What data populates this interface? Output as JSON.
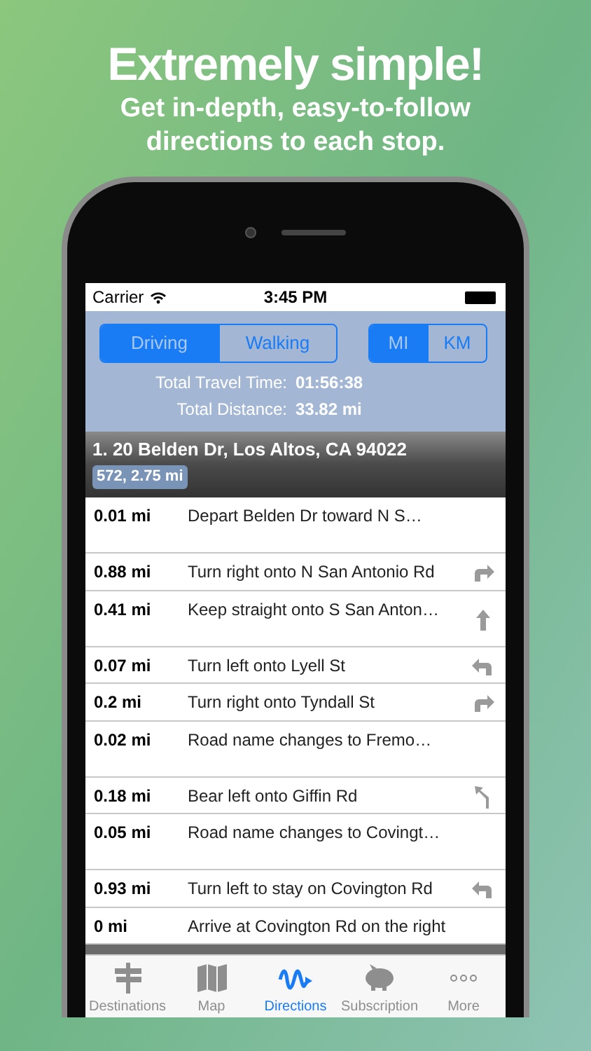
{
  "headline": "Extremely simple!",
  "subheadline": "Get in-depth, easy-to-follow directions to each stop.",
  "status_bar": {
    "carrier": "Carrier",
    "time": "3:45 PM"
  },
  "mode_tabs": [
    {
      "label": "Driving",
      "selected": true
    },
    {
      "label": "Walking",
      "selected": false
    }
  ],
  "unit_tabs": [
    {
      "label": "MI",
      "selected": true
    },
    {
      "label": "KM",
      "selected": false
    }
  ],
  "totals": [
    {
      "label": "Total Travel Time:",
      "value": "01:56:38"
    },
    {
      "label": "Total Distance:",
      "value": "33.82 mi"
    }
  ],
  "stop": {
    "title": "1. 20 Belden Dr, Los Altos, CA 94022",
    "badge": "572, 2.75 mi"
  },
  "steps": [
    {
      "distance": "0.01 mi",
      "instruction": "Depart Belden Dr toward N S…",
      "kind": "none",
      "two_line": true
    },
    {
      "distance": "0.88 mi",
      "instruction": "Turn right onto N San Antonio Rd",
      "kind": "right",
      "two_line": false
    },
    {
      "distance": "0.41 mi",
      "instruction": "Keep straight onto S San Anton…",
      "kind": "straight",
      "two_line": true
    },
    {
      "distance": "0.07 mi",
      "instruction": "Turn left onto Lyell St",
      "kind": "left",
      "two_line": false
    },
    {
      "distance": "0.2 mi",
      "instruction": "Turn right onto Tyndall St",
      "kind": "right",
      "two_line": false
    },
    {
      "distance": "0.02 mi",
      "instruction": "Road name changes to Fremo…",
      "kind": "none",
      "two_line": true
    },
    {
      "distance": "0.18 mi",
      "instruction": "Bear left onto Giffin Rd",
      "kind": "bear_left",
      "two_line": false
    },
    {
      "distance": "0.05 mi",
      "instruction": "Road name changes to Covingt…",
      "kind": "none",
      "two_line": true
    },
    {
      "distance": "0.93 mi",
      "instruction": "Turn left to stay on Covington Rd",
      "kind": "left",
      "two_line": false
    },
    {
      "distance": "0 mi",
      "instruction": "Arrive at Covington Rd on the right",
      "kind": "none",
      "two_line": false
    }
  ],
  "tab_bar": [
    {
      "label": "Destinations",
      "kind": "signpost",
      "selected": false
    },
    {
      "label": "Map",
      "kind": "map",
      "selected": false
    },
    {
      "label": "Directions",
      "kind": "route",
      "selected": true
    },
    {
      "label": "Subscription",
      "kind": "piggy",
      "selected": false
    },
    {
      "label": "More",
      "kind": "more",
      "selected": false
    }
  ]
}
